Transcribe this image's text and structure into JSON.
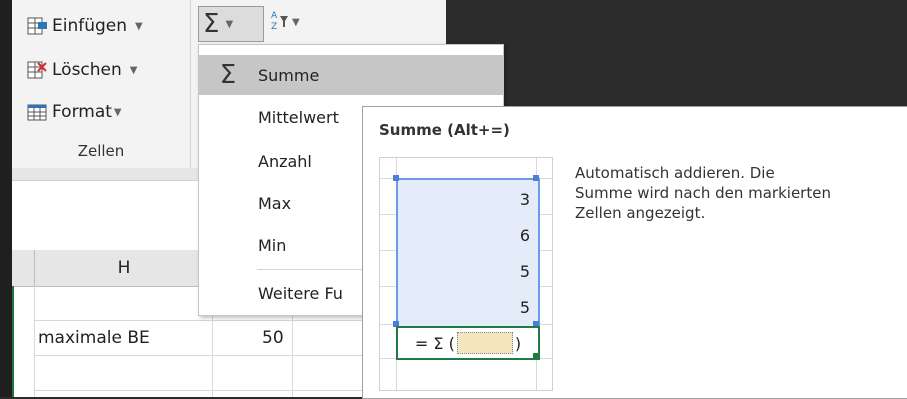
{
  "ribbon": {
    "insert_label": "Einfügen",
    "delete_label": "Löschen",
    "format_label": "Format",
    "group_label": "Zellen"
  },
  "dropdown": {
    "items": [
      {
        "label": "Summe",
        "icon": "sigma-icon"
      },
      {
        "label": "Mittelwert"
      },
      {
        "label": "Anzahl"
      },
      {
        "label": "Max"
      },
      {
        "label": "Min"
      },
      {
        "label": "Weitere Fu"
      }
    ]
  },
  "sheet": {
    "column_header": "H",
    "row_label": "maximale BE",
    "row_value": "50"
  },
  "tooltip": {
    "title": "Summe (Alt+=)",
    "desc_lines": [
      "Automatisch addieren. Die",
      "Summe wird nach den markierten",
      "Zellen angezeigt."
    ],
    "values": [
      "3",
      "6",
      "5",
      "5"
    ],
    "formula_prefix": "= Σ (",
    "formula_suffix": ")"
  }
}
